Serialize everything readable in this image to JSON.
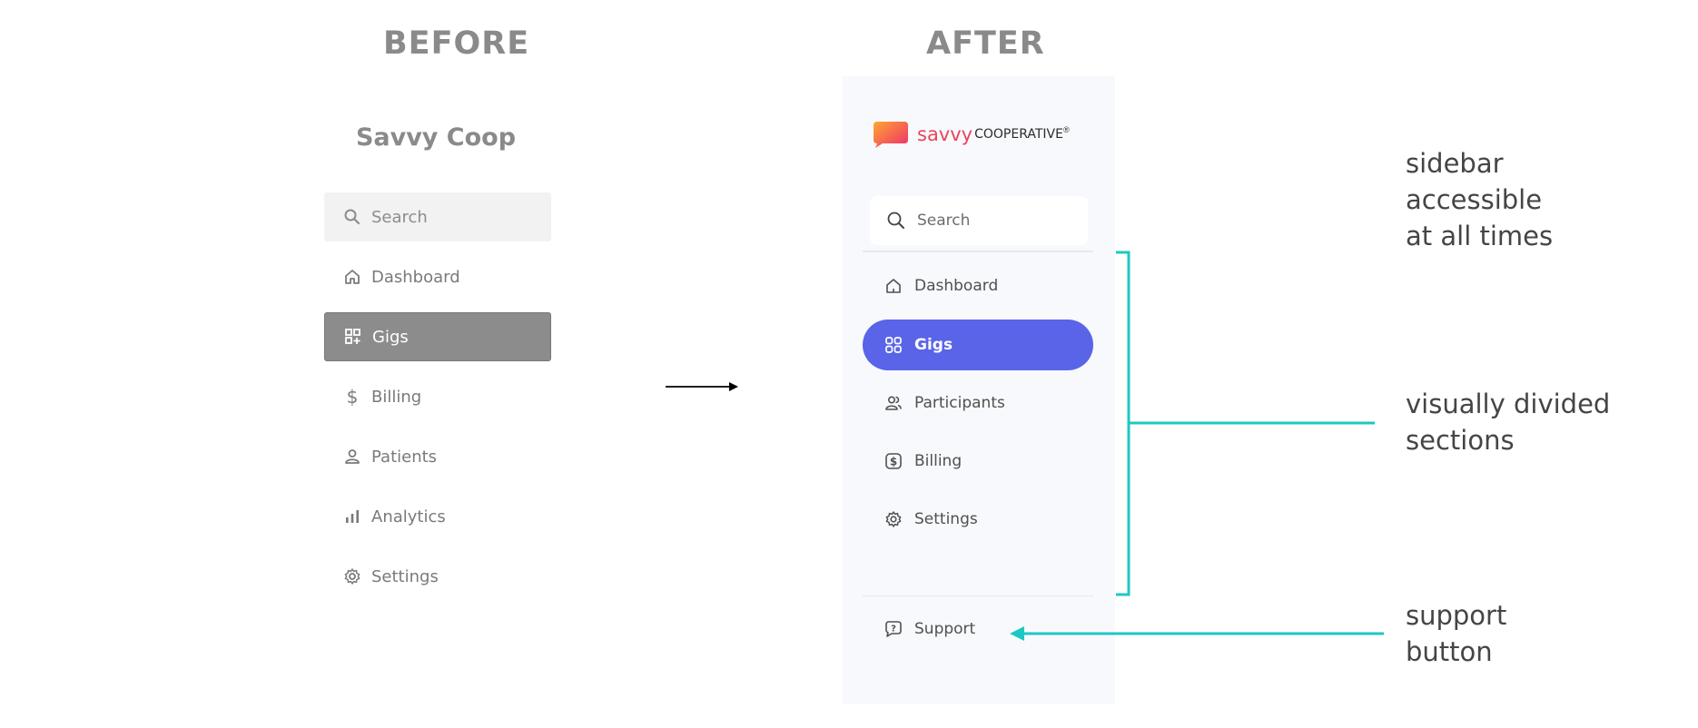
{
  "headings": {
    "before": "BEFORE",
    "after": "AFTER"
  },
  "before": {
    "title": "Savvy Coop",
    "search_placeholder": "Search",
    "items": [
      {
        "label": "Dashboard",
        "icon": "home-icon"
      },
      {
        "label": "Gigs",
        "icon": "grid-plus-icon",
        "active": true
      },
      {
        "label": "Billing",
        "icon": "dollar-icon"
      },
      {
        "label": "Patients",
        "icon": "person-icon"
      },
      {
        "label": "Analytics",
        "icon": "bar-chart-icon"
      },
      {
        "label": "Settings",
        "icon": "gear-icon"
      }
    ]
  },
  "after": {
    "logo": {
      "wordmark_savvy": "savvy",
      "wordmark_coop": "COOPERATIVE",
      "reg": "®"
    },
    "search_placeholder": "Search",
    "items": [
      {
        "label": "Dashboard",
        "icon": "home-icon"
      },
      {
        "label": "Gigs",
        "icon": "grid-icon",
        "active": true
      },
      {
        "label": "Participants",
        "icon": "people-icon"
      },
      {
        "label": "Billing",
        "icon": "dollar-badge-icon"
      },
      {
        "label": "Settings",
        "icon": "gear-icon"
      }
    ],
    "support": {
      "label": "Support",
      "icon": "support-chat-icon"
    }
  },
  "annotations": {
    "sidebar": [
      "sidebar",
      "accessible",
      "at all times"
    ],
    "sections": [
      "visually divided",
      "sections"
    ],
    "support": [
      "support",
      "button"
    ]
  },
  "colors": {
    "accent": "#5a64e8",
    "annotation_line": "#1ec8c2",
    "before_active": "#8c8c8c",
    "panel_bg": "#f8f9fd"
  }
}
